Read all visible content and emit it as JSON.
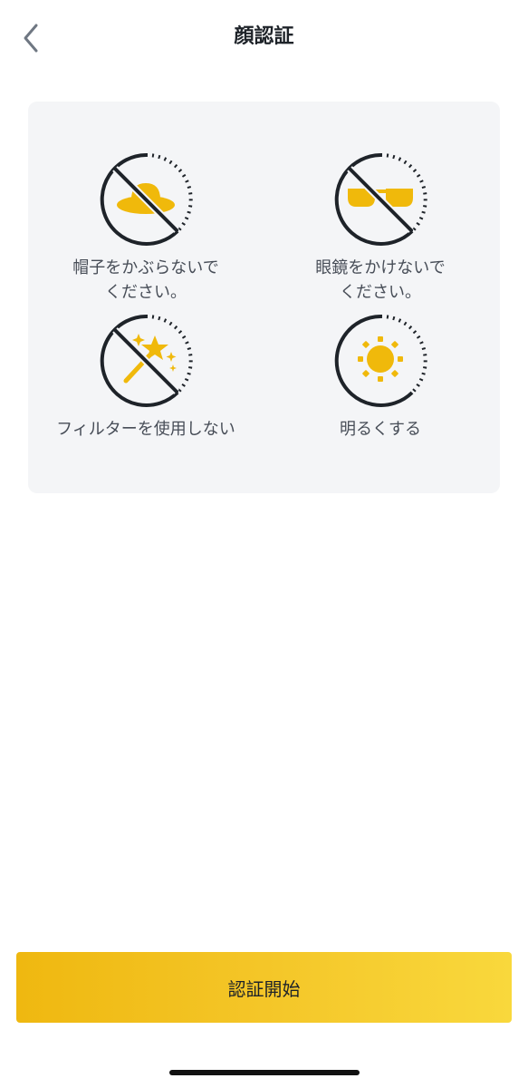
{
  "header": {
    "title": "顔認証",
    "back_icon": "chevron-left-icon"
  },
  "tips": [
    {
      "icon": "no-hat-icon",
      "label": "帽子をかぶらないで\nください。"
    },
    {
      "icon": "no-glasses-icon",
      "label": "眼鏡をかけないで\nください。"
    },
    {
      "icon": "no-filter-icon",
      "label": "フィルターを使用しない"
    },
    {
      "icon": "bright-light-icon",
      "label": "明るくする"
    }
  ],
  "footer": {
    "start_label": "認証開始"
  },
  "colors": {
    "accent": "#F0B90B",
    "icon_line": "#1E2329",
    "card_background": "#F4F5F7",
    "label_text": "#474D57"
  }
}
